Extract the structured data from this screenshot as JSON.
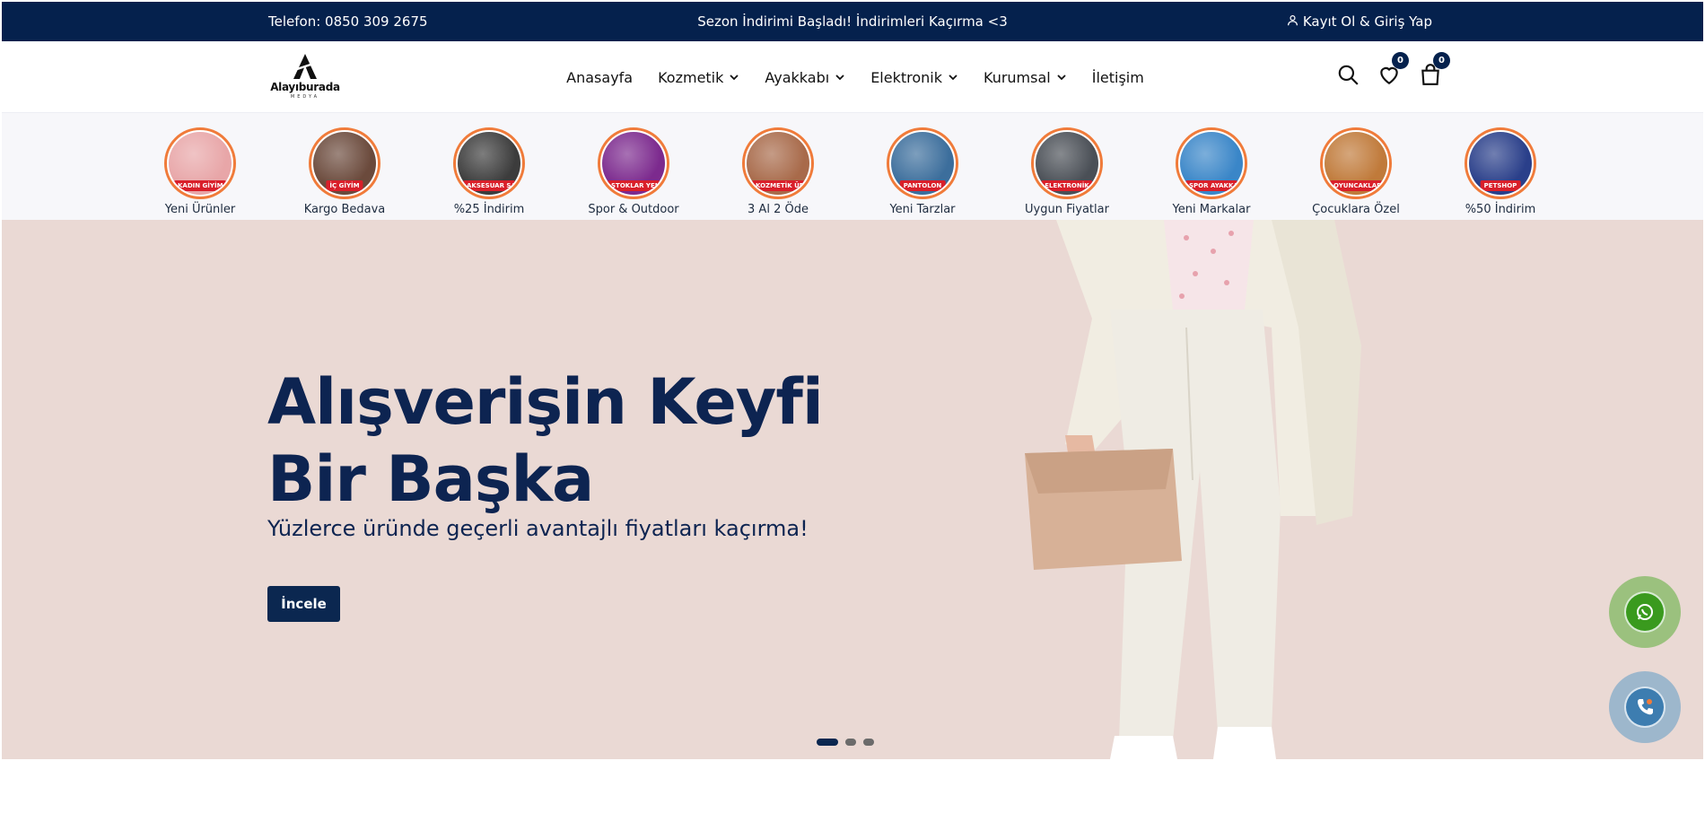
{
  "topbar": {
    "phone": "Telefon: 0850 309 2675",
    "promo": "Sezon İndirimi Başladı! İndirimleri Kaçırma <3",
    "auth": "Kayıt Ol & Giriş Yap"
  },
  "logo": {
    "name": "Alayıburada",
    "sub": "MEDYA"
  },
  "nav": {
    "items": [
      {
        "label": "Anasayfa",
        "dropdown": false
      },
      {
        "label": "Kozmetik",
        "dropdown": true
      },
      {
        "label": "Ayakkabı",
        "dropdown": true
      },
      {
        "label": "Elektronik",
        "dropdown": true
      },
      {
        "label": "Kurumsal",
        "dropdown": true
      },
      {
        "label": "İletişim",
        "dropdown": false
      }
    ]
  },
  "header_icons": {
    "search": "search-icon",
    "wishlist": "heart-icon",
    "wishlist_count": "0",
    "cart": "shopping-bag-icon",
    "cart_count": "0"
  },
  "stories": [
    {
      "tag": "KADIN GİYİM",
      "caption": "Yeni Ürünler",
      "color": "#e8a6a8"
    },
    {
      "tag": "İÇ GİYİM",
      "caption": "Kargo Bedava",
      "color": "#6b4a3c"
    },
    {
      "tag": "AKSESUAR SAAT",
      "caption": "%25 İndirim",
      "color": "#3c3c3c"
    },
    {
      "tag": "STOKLAR YENİLENDİ",
      "caption": "Spor & Outdoor",
      "color": "#7c2a8e"
    },
    {
      "tag": "KOZMETİK ÜRÜNLER",
      "caption": "3 Al 2 Öde",
      "color": "#a86a4a"
    },
    {
      "tag": "PANTOLON",
      "caption": "Yeni Tarzlar",
      "color": "#3c6e9c"
    },
    {
      "tag": "ELEKTRONİK",
      "caption": "Uygun Fiyatlar",
      "color": "#4a4f56"
    },
    {
      "tag": "SPOR AYAKKABI",
      "caption": "Yeni Markalar",
      "color": "#3a86c8"
    },
    {
      "tag": "OYUNCAKLAR",
      "caption": "Çocuklara Özel",
      "color": "#c07a3a"
    },
    {
      "tag": "PETSHOP",
      "caption": "%50 İndirim",
      "color": "#2a3f8a"
    }
  ],
  "hero": {
    "title_line1": "Alışverişin Keyfi",
    "title_line2": "Bir Başka",
    "subtitle": "Yüzlerce üründe geçerli avantajlı fiyatları kaçırma!",
    "button": "İncele",
    "slides": 3,
    "active_slide": 1
  },
  "floating": {
    "whatsapp": "whatsapp-icon",
    "call": "phone-icon"
  },
  "colors": {
    "navy": "#05214d",
    "accent_ring": "#f07b3a",
    "hero_bg": "#ead9d4",
    "tag_red": "#d91f2a"
  }
}
